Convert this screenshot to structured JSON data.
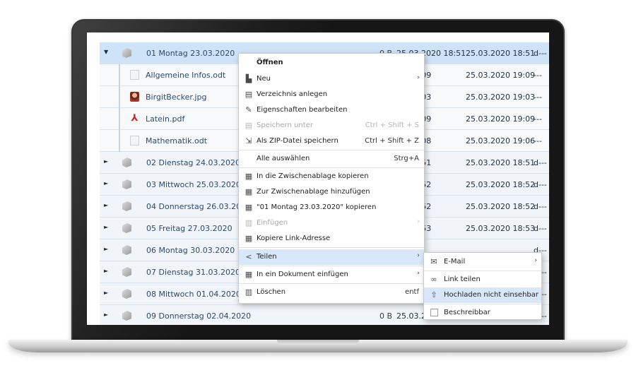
{
  "files": [
    {
      "toggle": "▼",
      "icon": "folder-icon",
      "name": "01 Montag 23.03.2020",
      "size": "0 B",
      "date1": "25.03.2020 18:51",
      "date2": "25.03.2020 18:51",
      "perm": "d---"
    },
    {
      "toggle": "",
      "icon": "document-icon",
      "name": "Allgemeine Infos.odt",
      "size": "",
      "date1": "20 19:09",
      "date2": "25.03.2020 19:09",
      "perm": "---"
    },
    {
      "toggle": "",
      "icon": "image-icon",
      "name": "BirgitBecker.jpg",
      "size": "",
      "date1": "20 19:03",
      "date2": "25.03.2020 19:03",
      "perm": "---"
    },
    {
      "toggle": "",
      "icon": "pdf-icon",
      "name": "Latein.pdf",
      "size": "",
      "date1": "20 19:09",
      "date2": "25.03.2020 19:09",
      "perm": "---"
    },
    {
      "toggle": "",
      "icon": "document-icon",
      "name": "Mathematik.odt",
      "size": "",
      "date1": "20 19:08",
      "date2": "25.03.2020 19:06",
      "perm": "---"
    },
    {
      "toggle": "►",
      "icon": "folder-icon",
      "name": "02 Dienstag 24.03.2020",
      "size": "",
      "date1": "20 18:51",
      "date2": "25.03.2020 18:51",
      "perm": "d---"
    },
    {
      "toggle": "►",
      "icon": "folder-icon",
      "name": "03 Mittwoch 25.03.2020",
      "size": "",
      "date1": "20 18:52",
      "date2": "25.03.2020 18:52",
      "perm": "d---"
    },
    {
      "toggle": "►",
      "icon": "folder-icon",
      "name": "04 Donnerstag 26.03.2020",
      "size": "",
      "date1": "20 18:52",
      "date2": "25.03.2020 18:52",
      "perm": "d---"
    },
    {
      "toggle": "►",
      "icon": "folder-icon",
      "name": "05 Freitag 27.03.2020",
      "size": "",
      "date1": "20 18:53",
      "date2": "25.03.2020 18:53",
      "perm": "d---"
    },
    {
      "toggle": "►",
      "icon": "folder-icon",
      "name": "06 Montag 30.03.2020",
      "size": "",
      "date1": "",
      "date2": "",
      "perm": "d---"
    },
    {
      "toggle": "►",
      "icon": "folder-icon",
      "name": "07 Dienstag 31.03.2020",
      "size": "",
      "date1": "",
      "date2": "",
      "perm": "d---"
    },
    {
      "toggle": "►",
      "icon": "folder-icon",
      "name": "08 Mittwoch 01.04.2020",
      "size": "",
      "date1": "",
      "date2": "",
      "perm": "d---"
    },
    {
      "toggle": "►",
      "icon": "folder-icon",
      "name": "09 Donnerstag 02.04.2020",
      "size": "0 B",
      "date1": "25.03.20",
      "date2": "",
      "perm": "d---"
    }
  ],
  "context_menu": {
    "open": "Öffnen",
    "items": [
      {
        "icon": "new-file-icon",
        "label": "Neu",
        "shortcut": "",
        "arrow": "›",
        "disabled": false
      },
      {
        "icon": "folder-add-icon",
        "label": "Verzeichnis anlegen",
        "shortcut": "",
        "arrow": "",
        "disabled": false
      },
      {
        "icon": "pencil-icon",
        "label": "Eigenschaften bearbeiten",
        "shortcut": "",
        "arrow": "",
        "disabled": false
      },
      {
        "icon": "save-icon",
        "label": "Speichern unter",
        "shortcut": "Ctrl + Shift + S",
        "arrow": "",
        "disabled": true
      },
      {
        "icon": "zip-icon",
        "label": "Als ZIP-Datei speichern",
        "shortcut": "Ctrl + Shift + Z",
        "arrow": "",
        "disabled": false
      },
      {
        "icon": "",
        "label": "Alle auswählen",
        "shortcut": "Strg+A",
        "arrow": "",
        "disabled": false
      },
      {
        "icon": "clipboard-icon",
        "label": "In die Zwischenablage kopieren",
        "shortcut": "",
        "arrow": "",
        "disabled": false
      },
      {
        "icon": "clipboard-add-icon",
        "label": "Zur Zwischenablage hinzufügen",
        "shortcut": "",
        "arrow": "",
        "disabled": false
      },
      {
        "icon": "copy-icon",
        "label": "\"01 Montag 23.03.2020\" kopieren",
        "shortcut": "",
        "arrow": "",
        "disabled": false
      },
      {
        "icon": "paste-icon",
        "label": "Einfügen",
        "shortcut": "",
        "arrow": "›",
        "disabled": true
      },
      {
        "icon": "link-copy-icon",
        "label": "Kopiere Link-Adresse",
        "shortcut": "",
        "arrow": "",
        "disabled": false
      },
      {
        "icon": "share-icon",
        "label": "Teilen",
        "shortcut": "",
        "arrow": "›",
        "disabled": false
      },
      {
        "icon": "insert-doc-icon",
        "label": "In ein Dokument einfügen",
        "shortcut": "",
        "arrow": "›",
        "disabled": false
      },
      {
        "icon": "trash-icon",
        "label": "Löschen",
        "shortcut": "entf",
        "arrow": "",
        "disabled": false
      }
    ]
  },
  "share_submenu": {
    "items": [
      {
        "icon": "mail-icon",
        "label": "E-Mail",
        "arrow": "›"
      },
      {
        "icon": "link-icon",
        "label": "Link teilen",
        "arrow": ""
      },
      {
        "icon": "upload-icon",
        "label": "Hochladen nicht einsehbar",
        "arrow": ""
      },
      {
        "icon": "checkbox",
        "label": "Beschreibbar",
        "arrow": ""
      }
    ]
  },
  "colors": {
    "selection": "#cfe3f7",
    "menu_highlight": "#d8e8fa",
    "link_text": "#2c4a6e"
  }
}
